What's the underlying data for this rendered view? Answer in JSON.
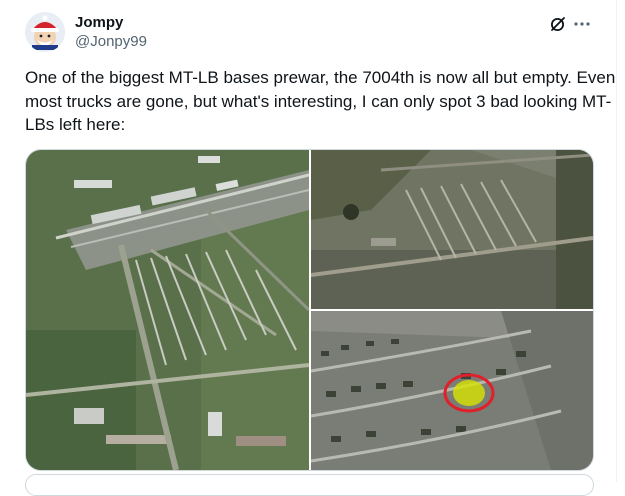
{
  "post": {
    "author_name": "Jompy",
    "author_handle": "@Jonpy99",
    "text": "One of the biggest MT-LB bases prewar, the 7004th is now all but empty. Even most trucks are gone, but what's interesting, I can only spot 3 bad looking MT-LBs left here:"
  },
  "icons": {
    "grok": "grok-slash-circle-icon",
    "more": "more-dots-icon"
  },
  "colors": {
    "text": "#0f1419",
    "secondary_text": "#536471",
    "border": "#cfd9de",
    "highlight": "#e0202a",
    "highlight_fill": "#d8e400"
  },
  "media": {
    "count": 3,
    "images": [
      "satellite-base-overview",
      "satellite-base-north-sector",
      "satellite-vehicle-park-closeup"
    ]
  }
}
